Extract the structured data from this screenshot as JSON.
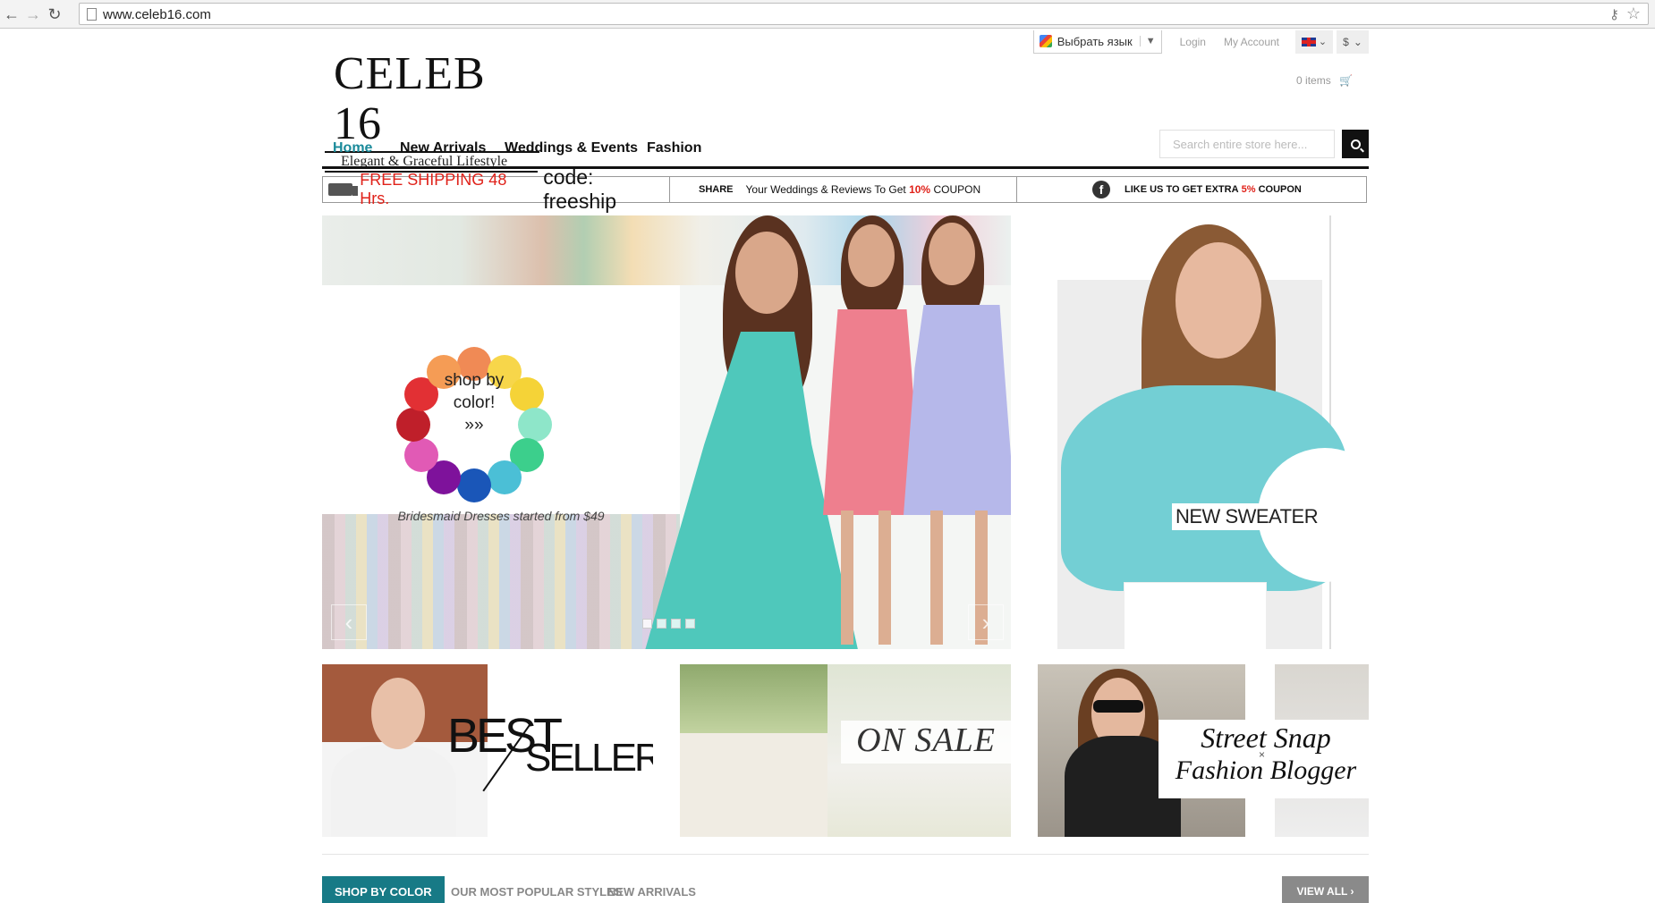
{
  "browser": {
    "url": "www.celeb16.com"
  },
  "topbar": {
    "language": "Выбрать язык",
    "login": "Login",
    "account": "My Account",
    "currency": "$"
  },
  "logo": {
    "name": "CELEB 16",
    "tagline": "Elegant & Graceful Lifestyle"
  },
  "cart": {
    "label": "0 items"
  },
  "nav": {
    "items": [
      "Home",
      "New Arrivals",
      "Weddings & Events",
      "Fashion"
    ]
  },
  "search": {
    "placeholder": "Search entire store here..."
  },
  "promo": {
    "shipping": "FREE SHIPPING 48 Hrs.",
    "code": "code: freeship",
    "share_label": "SHARE",
    "share_text": "Your Weddings & Reviews To Get",
    "share_pct": "10%",
    "share_suffix": "COUPON",
    "like_text": "LIKE US TO GET EXTRA",
    "like_pct": "5%",
    "like_suffix": "COUPON"
  },
  "hero": {
    "wheel_line1": "shop by",
    "wheel_line2": "color!",
    "wheel_arrows": "»»",
    "caption": "Bridesmaid Dresses started from $49",
    "wheel_colors": [
      "#f08a55",
      "#f7d64a",
      "#f5d337",
      "#8ee6c9",
      "#3ccf8c",
      "#4bbfd6",
      "#1a56b8",
      "#7e129b",
      "#e15ab5",
      "#bf1f2a",
      "#e23034",
      "#f59c55"
    ]
  },
  "sweater": {
    "label": "NEW SWEATER"
  },
  "tiles": {
    "best": "BEST",
    "sellers": "SELLERS",
    "sale": "ON SALE",
    "street": "Street Snap",
    "blogger": "Fashion Blogger"
  },
  "tabs": {
    "items": [
      "SHOP BY COLOR",
      "OUR MOST POPULAR STYLES",
      "NEW ARRIVALS"
    ],
    "view_all": "VIEW ALL ›"
  },
  "colors": {
    "accent": "#177a86",
    "nav_active": "#1a8a9a",
    "promo_red": "#e0221a"
  }
}
